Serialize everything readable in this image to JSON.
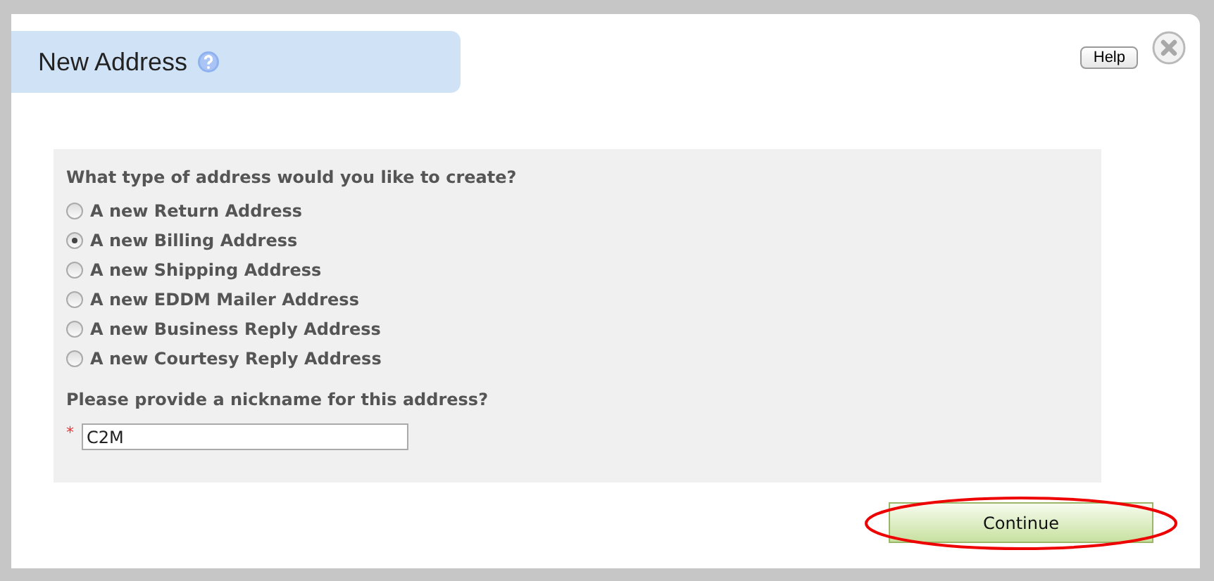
{
  "dialog": {
    "title": "New Address",
    "help_button": "Help"
  },
  "address_type": {
    "question": "What type of address would you like to create?",
    "options": [
      {
        "label": "A new Return Address",
        "selected": false
      },
      {
        "label": "A new Billing Address",
        "selected": true
      },
      {
        "label": "A new Shipping Address",
        "selected": false
      },
      {
        "label": "A new EDDM Mailer Address",
        "selected": false
      },
      {
        "label": "A new Business Reply Address",
        "selected": false
      },
      {
        "label": "A new Courtesy Reply Address",
        "selected": false
      }
    ]
  },
  "nickname": {
    "question": "Please provide a nickname for this address?",
    "required_mark": "*",
    "value": "C2M"
  },
  "continue_button": "Continue"
}
